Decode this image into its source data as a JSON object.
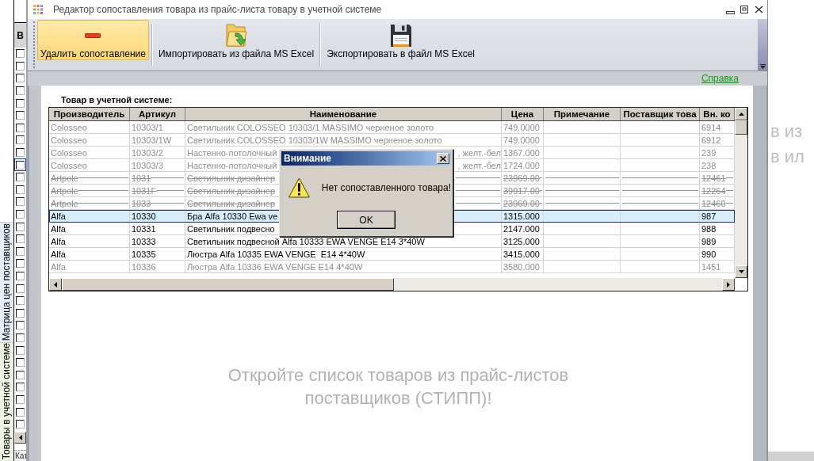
{
  "background_left": {
    "column_header": "В",
    "checkboxes": [
      {
        "checked": false,
        "focused": false
      },
      {
        "checked": false,
        "focused": false
      },
      {
        "checked": false,
        "focused": false
      },
      {
        "checked": false,
        "focused": false
      },
      {
        "checked": false,
        "focused": false
      },
      {
        "checked": false,
        "focused": false
      },
      {
        "checked": false,
        "focused": false
      },
      {
        "checked": false,
        "focused": false
      },
      {
        "checked": false,
        "focused": false
      },
      {
        "checked": false,
        "focused": true
      },
      {
        "checked": false,
        "focused": false
      },
      {
        "checked": false,
        "focused": false
      },
      {
        "checked": false,
        "focused": false
      },
      {
        "checked": false,
        "focused": false
      },
      {
        "checked": false,
        "focused": false
      },
      {
        "checked": false,
        "focused": false
      },
      {
        "checked": false,
        "focused": false
      },
      {
        "checked": false,
        "focused": false
      },
      {
        "checked": false,
        "focused": false
      },
      {
        "checked": false,
        "focused": false
      },
      {
        "checked": false,
        "focused": false
      },
      {
        "checked": false,
        "focused": false
      },
      {
        "checked": false,
        "focused": false
      },
      {
        "checked": false,
        "focused": false
      },
      {
        "checked": false,
        "focused": false
      },
      {
        "checked": false,
        "focused": false
      },
      {
        "checked": false,
        "focused": false
      },
      {
        "checked": false,
        "focused": false
      },
      {
        "checked": false,
        "focused": false
      },
      {
        "checked": false,
        "focused": false
      },
      {
        "checked": false,
        "focused": false
      }
    ],
    "tabs": [
      {
        "label": "Матрица цен поставщиков",
        "color": "#e5eef8"
      },
      {
        "label": "Товары в учетной системе",
        "color": "#eef6e3"
      }
    ],
    "bottom_tab": "Кат"
  },
  "window": {
    "title": "Редактор сопоставления товара из прайс-листа товару в учетной системе",
    "toolbar": [
      {
        "kind": "delete",
        "label": "Удалить сопоставление",
        "highlighted": true
      },
      {
        "kind": "import",
        "label": "Импортировать из файла MS Excel",
        "highlighted": false
      },
      {
        "kind": "export",
        "label": "Экспортировать в файл MS Excel",
        "highlighted": false
      }
    ],
    "help_link": "Справка",
    "table": {
      "caption": "Товар в учетной системе:",
      "columns": [
        "Производитель",
        "Артикул",
        "Наименование",
        "Цена",
        "Примечание",
        "Поставщик това",
        "Вн. ко"
      ],
      "rows": [
        {
          "manufacturer": "Colosseo",
          "article": "10303/1",
          "name": "Светильник COLOSSEO 10303/1 MASSIMO черненое золото",
          "price": "749.0000",
          "code": "6914",
          "disabled": true,
          "struck": false,
          "selected": false
        },
        {
          "manufacturer": "Colosseo",
          "article": "10303/1W",
          "name": "Светильник COLOSSEO 10303/1W MASSIMO черненое золото",
          "price": "749.0000",
          "code": "6912",
          "disabled": true,
          "struck": false,
          "selected": false
        },
        {
          "manufacturer": "Colosseo",
          "article": "10303/2",
          "name": "Настенно-потолочный",
          "name_end": ", желт.-бел",
          "price": "1367.000",
          "code": "239",
          "disabled": true,
          "struck": false,
          "selected": false
        },
        {
          "manufacturer": "Colosseo",
          "article": "10303/3",
          "name": "Настенно-потолочный",
          "name_end": ", желт.-бел",
          "price": "1724.000",
          "code": "238",
          "disabled": true,
          "struck": false,
          "selected": false
        },
        {
          "manufacturer": "Artpole",
          "article": "1031",
          "name": "Светильник дизайнер",
          "price": "23969.00",
          "code": "12461",
          "disabled": true,
          "struck": true,
          "selected": false
        },
        {
          "manufacturer": "Artpole",
          "article": "1031F",
          "name": "Светильник дизайнер",
          "price": "39917.00",
          "code": "12264",
          "disabled": true,
          "struck": true,
          "selected": false
        },
        {
          "manufacturer": "Artpole",
          "article": "1033",
          "name": "Светильник дизайнер",
          "price": "23969.00",
          "code": "12460",
          "disabled": true,
          "struck": true,
          "selected": false
        },
        {
          "manufacturer": "Alfa",
          "article": "10330",
          "name": "Бра Alfa 10330 Ewa ve",
          "price": "1315.000",
          "code": "987",
          "disabled": false,
          "struck": false,
          "selected": true
        },
        {
          "manufacturer": "Alfa",
          "article": "10331",
          "name": "Светильник подвесно",
          "price": "2147.000",
          "code": "988",
          "disabled": false,
          "struck": false,
          "selected": false
        },
        {
          "manufacturer": "Alfa",
          "article": "10333",
          "name": "Светильник подвесной Alfa 10333 EWA VENGE E14 3*40W",
          "price": "3125.000",
          "code": "989",
          "disabled": false,
          "struck": false,
          "selected": false
        },
        {
          "manufacturer": "Alfa",
          "article": "10335",
          "name": "Люстра Alfa 10335 EWA VENGE  E14 4*40W",
          "price": "3415.000",
          "code": "990",
          "disabled": false,
          "struck": false,
          "selected": false
        },
        {
          "manufacturer": "Alfa",
          "article": "10336",
          "name": "Люстра Alfa 10336 EWA VENGE E14 4*40W",
          "price": "3580.000",
          "code": "1451",
          "disabled": true,
          "struck": false,
          "selected": false
        }
      ]
    },
    "empty_list_message": "Откройте список товаров из прайс-листов поставщиков (СТИПП)!"
  },
  "dialog": {
    "title": "Внимание",
    "message": "Нет сопоставленного товара!",
    "button": "OK"
  },
  "background_right": {
    "texts": [
      "в из",
      "в ил"
    ]
  }
}
